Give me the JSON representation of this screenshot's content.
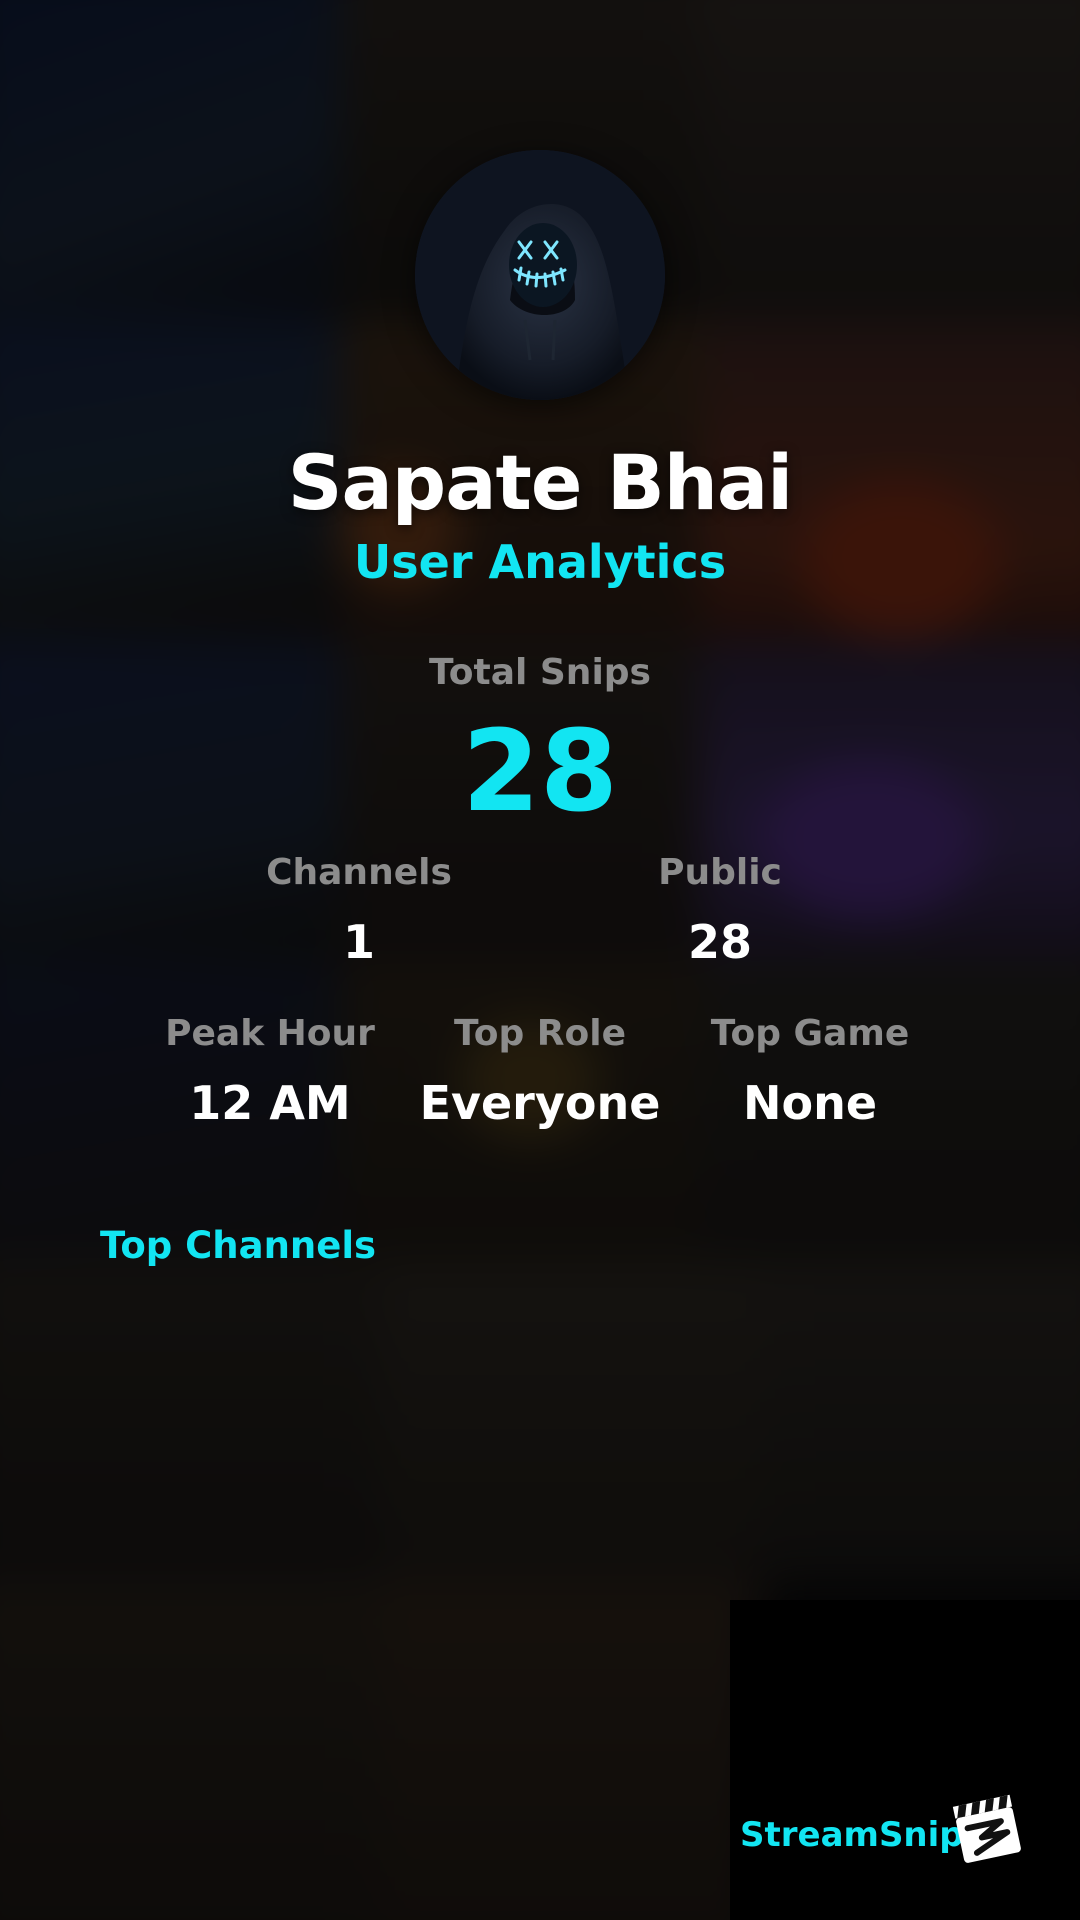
{
  "profile": {
    "username": "Sapate Bhai",
    "subtitle": "User Analytics",
    "avatar_icon": "hooded-figure-neon-mask-avatar"
  },
  "stats": {
    "total_snips_label": "Total Snips",
    "total_snips_value": "28",
    "channels_label": "Channels",
    "channels_value": "1",
    "public_label": "Public",
    "public_value": "28",
    "peak_hour_label": "Peak Hour",
    "peak_hour_value": "12 AM",
    "top_role_label": "Top Role",
    "top_role_value": "Everyone",
    "top_game_label": "Top Game",
    "top_game_value": "None"
  },
  "sections": {
    "top_channels_label": "Top Channels"
  },
  "brand": {
    "name": "StreamSnip",
    "logo_icon": "clapperboard-logo-icon"
  },
  "colors": {
    "accent": "#12e5f2",
    "label_gray": "#8c8c8c",
    "text_white": "#ffffff",
    "background": "#0b0b0d"
  }
}
